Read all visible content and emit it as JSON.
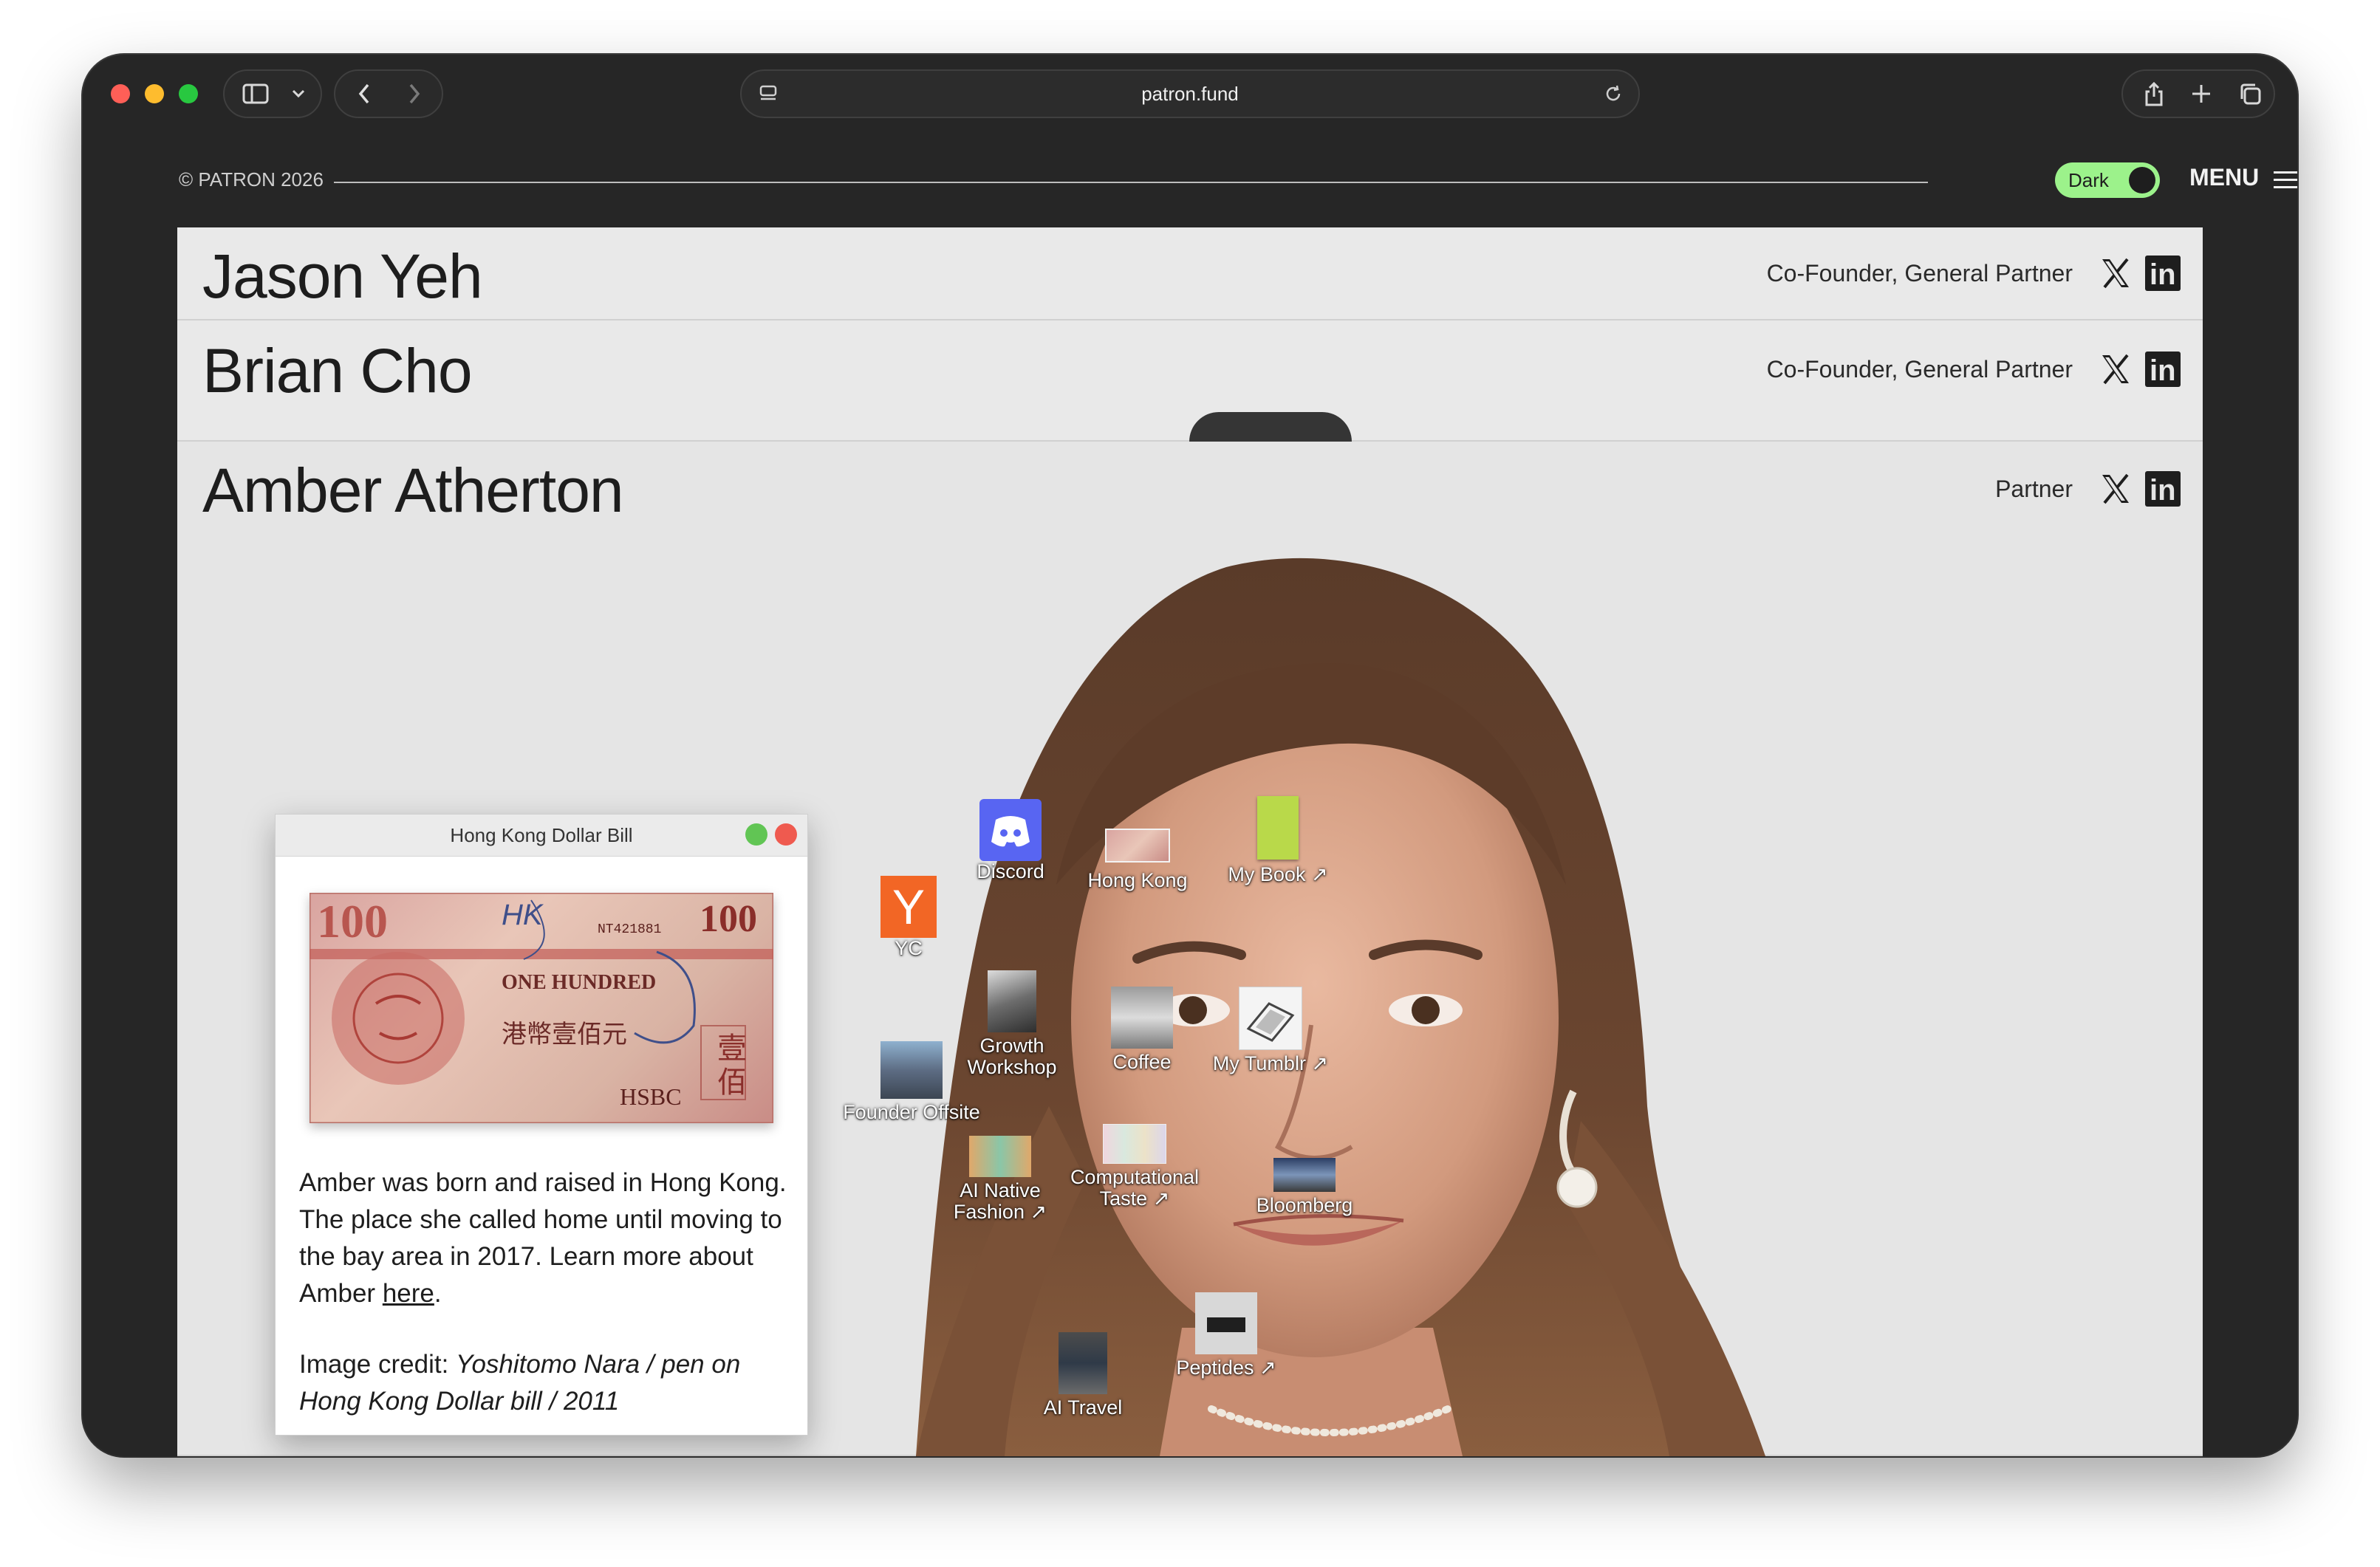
{
  "browser": {
    "url": "patron.fund"
  },
  "header": {
    "copyright": "© PATRON 2026",
    "theme_toggle_label": "Dark",
    "menu_label": "MENU"
  },
  "team": [
    {
      "name": "Jason Yeh",
      "role": "Co-Founder, General Partner"
    },
    {
      "name": "Brian Cho",
      "role": "Co-Founder, General Partner"
    },
    {
      "name": "Amber Atherton",
      "role": "Partner"
    }
  ],
  "popup": {
    "title": "Hong Kong Dollar Bill",
    "bill": {
      "top_left_number": "100",
      "top_right_number": "100",
      "serial": "NT421881",
      "english_text": "ONE HUNDRED",
      "chinese_text": "港幣壹佰元",
      "bank": "HSBC",
      "side_chars": "壹佰",
      "stamp": "HK"
    },
    "body_prefix": "Amber was born and raised in Hong Kong. The place she called home until moving to the bay area in 2017. Learn more about Amber ",
    "body_link": "here",
    "body_suffix": ".",
    "credit_prefix": "Image credit: ",
    "credit_italic": "Yoshitomo Nara / pen on Hong Kong Dollar bill / 2011"
  },
  "desktop_icons": [
    {
      "label": "YC",
      "icon": "yc-logo-icon",
      "color": "#f26625"
    },
    {
      "label": "Discord",
      "icon": "discord-icon",
      "color": "#5865f2"
    },
    {
      "label": "Hong Kong",
      "icon": "banknote-icon"
    },
    {
      "label": "My Book ↗",
      "icon": "book-cover-icon",
      "color": "#b9d94a"
    },
    {
      "label": "Growth Workshop",
      "icon": "photo-thumbnail-icon"
    },
    {
      "label": "Coffee",
      "icon": "coffee-photo-icon"
    },
    {
      "label": "My Tumblr ↗",
      "icon": "laptop-sketch-icon"
    },
    {
      "label": "Founder Offsite",
      "icon": "group-photo-icon"
    },
    {
      "label": "AI Native Fashion ↗",
      "icon": "fashion-thumbnail-icon"
    },
    {
      "label": "Computational Taste ↗",
      "icon": "palette-thumbnail-icon"
    },
    {
      "label": "Bloomberg",
      "icon": "tv-thumbnail-icon"
    },
    {
      "label": "Peptides ↗",
      "icon": "product-thumbnail-icon"
    },
    {
      "label": "AI Travel",
      "icon": "travel-photo-icon"
    }
  ]
}
